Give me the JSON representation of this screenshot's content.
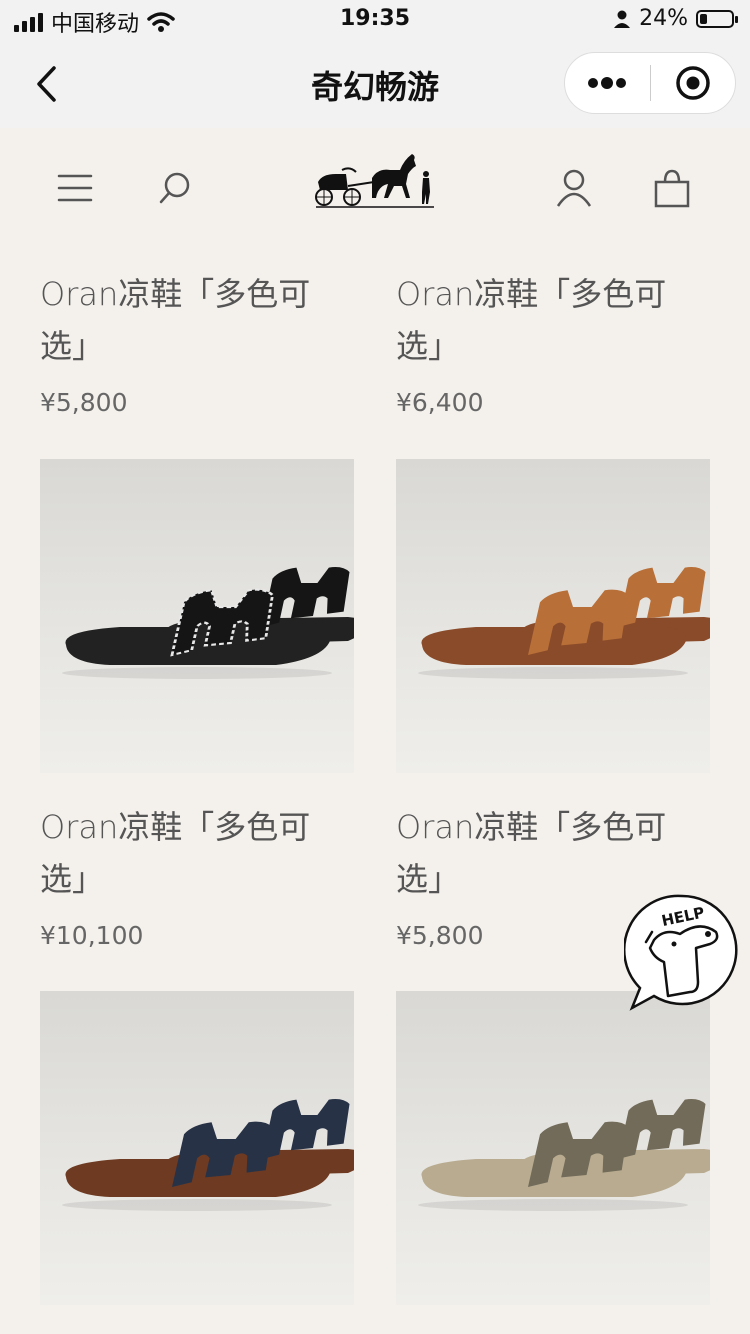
{
  "status_bar": {
    "carrier": "中国移动",
    "time": "19:35",
    "battery": "24%",
    "battery_level": 0.24
  },
  "nav": {
    "title": "奇幻畅游"
  },
  "products": [
    {
      "name": "Oran凉鞋「多色可选」",
      "price": "¥5,800",
      "image": "none"
    },
    {
      "name": "Oran凉鞋「多色可选」",
      "price": "¥6,400",
      "image": "none"
    },
    {
      "name": "Oran凉鞋「多色可选」",
      "price": "¥10,100",
      "image": "black-sandal",
      "sandal_color": "#151515",
      "sole_color": "#222222",
      "stitch": true
    },
    {
      "name": "Oran凉鞋「多色可选」",
      "price": "¥5,800",
      "image": "tan-sandal",
      "sandal_color": "#b86f38",
      "sole_color": "#8a4b2a",
      "stitch": false
    },
    {
      "name": "",
      "price": "",
      "image": "denim-sandal",
      "sandal_color": "#283247",
      "sole_color": "#6e3a22",
      "stitch": false
    },
    {
      "name": "",
      "price": "",
      "image": "olive-sandal",
      "sandal_color": "#726b59",
      "sole_color": "#b8ab90",
      "stitch": false
    }
  ],
  "help_badge": {
    "text": "HELP"
  },
  "colors": {
    "page_bg": "#f4f1ec",
    "bar_bg": "#f2f2f2"
  }
}
